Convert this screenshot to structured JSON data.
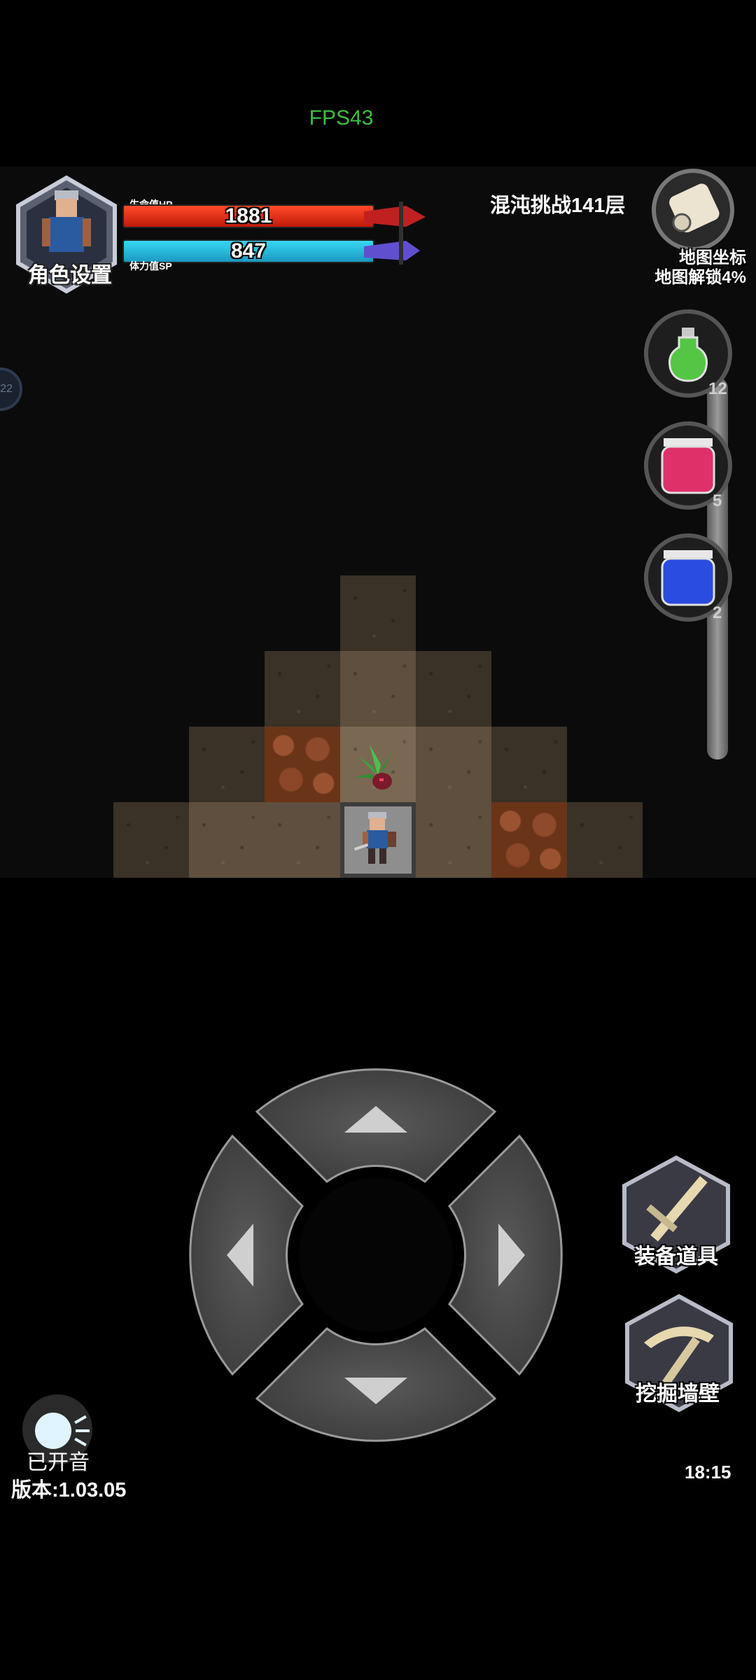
{
  "status": {
    "fps": "FPS43",
    "clock": "18:15",
    "version": "版本:1.03.05"
  },
  "hud": {
    "character_settings_label": "角色设置",
    "hp_tag": "生命值HP",
    "hp_value": "1881",
    "sp_tag": "体力值SP",
    "sp_value": "847",
    "challenge_label": "混沌挑战141层",
    "map_coords_label": "地图坐标",
    "map_unlock_label": "地图解锁4%"
  },
  "potions": [
    {
      "name": "green-potion",
      "count": "12",
      "color": "#55c545"
    },
    {
      "name": "red-potion",
      "count": "5",
      "color": "#e0306a"
    },
    {
      "name": "blue-potion",
      "count": "2",
      "color": "#2a4ce0"
    }
  ],
  "side_tab": {
    "text": "22"
  },
  "actions": {
    "equip_label": "装备道具",
    "dig_label": "挖掘墙壁"
  },
  "sound": {
    "label": "已开音"
  },
  "colors": {
    "hp": "#e0301a",
    "sp": "#30c0e8",
    "fps": "#3fbf3f"
  }
}
